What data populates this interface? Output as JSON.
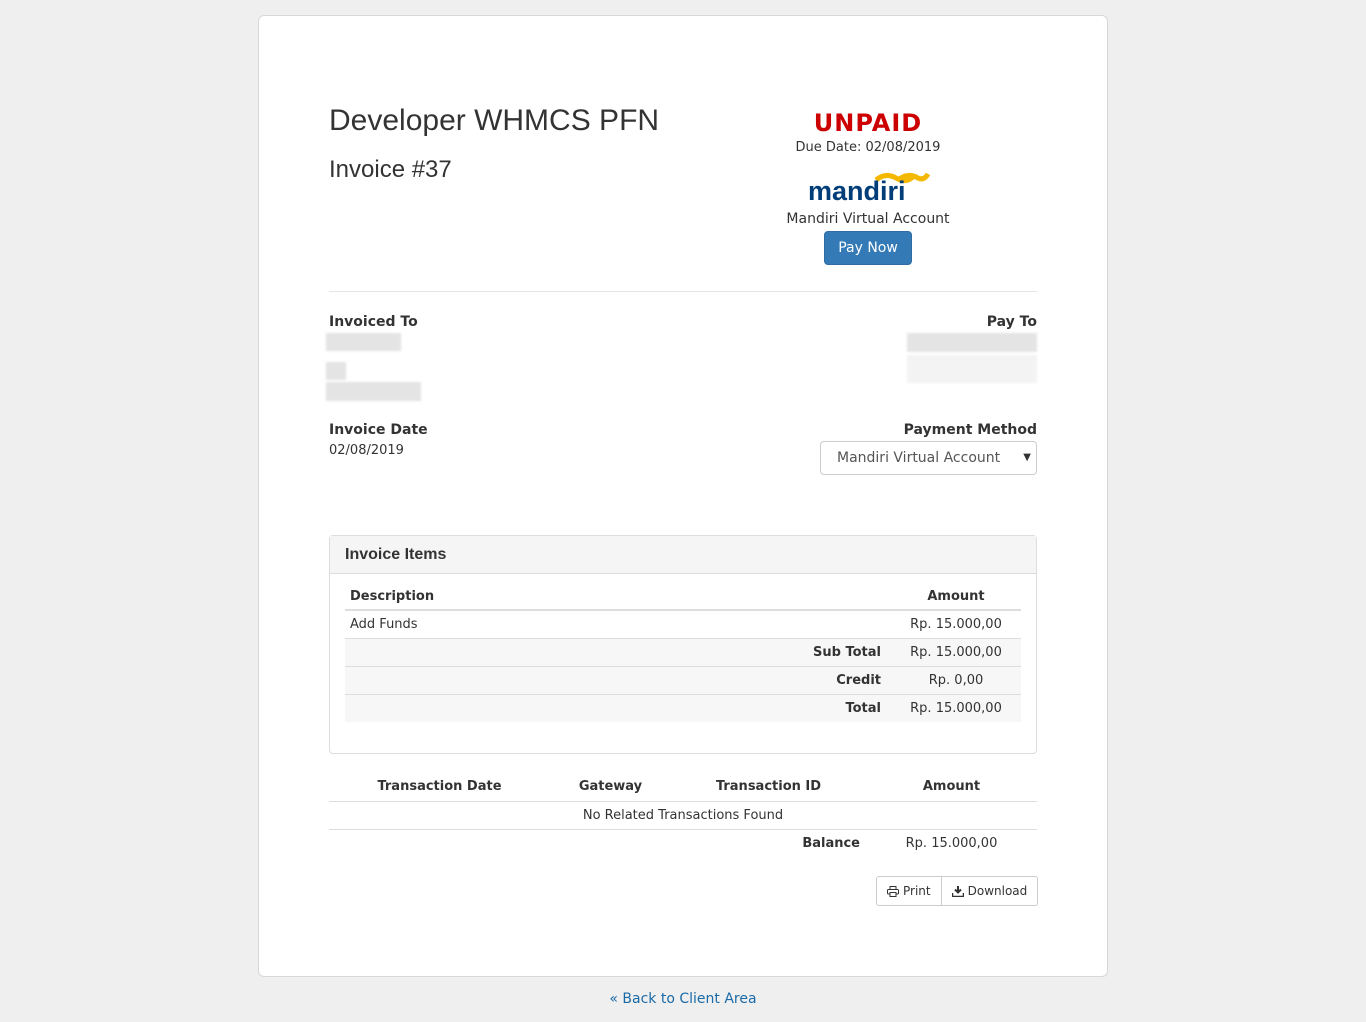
{
  "header": {
    "company": "Developer WHMCS PFN",
    "invoice_number": "Invoice #37",
    "status": "UNPAID",
    "due_date": "Due Date: 02/08/2019",
    "logo_text": "mandiri",
    "gateway_name": "Mandiri Virtual Account",
    "pay_now": "Pay Now"
  },
  "details": {
    "invoiced_to_label": "Invoiced To",
    "pay_to_label": "Pay To",
    "invoice_date_label": "Invoice Date",
    "invoice_date": "02/08/2019",
    "payment_method_label": "Payment Method",
    "payment_method_selected": "Mandiri Virtual Account"
  },
  "items": {
    "title": "Invoice Items",
    "col_description": "Description",
    "col_amount": "Amount",
    "rows": [
      {
        "description": "Add Funds",
        "amount": "Rp. 15.000,00"
      }
    ],
    "subtotal_label": "Sub Total",
    "subtotal": "Rp. 15.000,00",
    "credit_label": "Credit",
    "credit": "Rp. 0,00",
    "total_label": "Total",
    "total": "Rp. 15.000,00"
  },
  "transactions": {
    "col_date": "Transaction Date",
    "col_gateway": "Gateway",
    "col_id": "Transaction ID",
    "col_amount": "Amount",
    "empty": "No Related Transactions Found",
    "balance_label": "Balance",
    "balance": "Rp. 15.000,00"
  },
  "actions": {
    "print": "Print",
    "download": "Download",
    "print_icon": "print-icon",
    "download_icon": "download-icon"
  },
  "footer": {
    "back_link": "« Back to Client Area"
  },
  "colors": {
    "status_unpaid": "#cc0000",
    "primary": "#337ab7",
    "link": "#1a6aa8",
    "logo_blue": "#003d79",
    "logo_gold": "#f5b800"
  }
}
